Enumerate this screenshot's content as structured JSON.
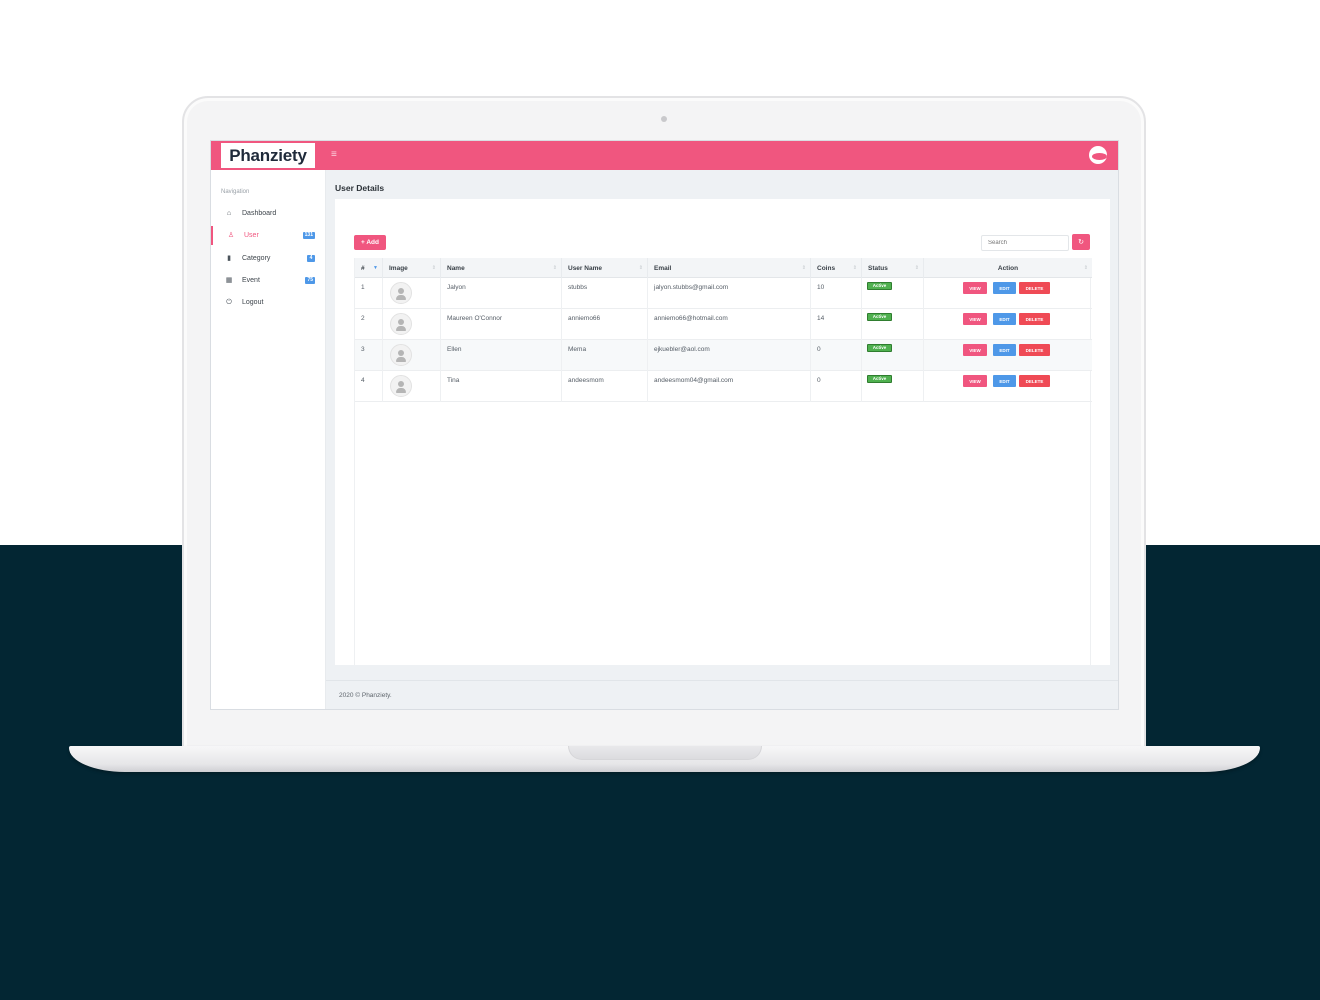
{
  "header": {
    "logo_text": "Phanziety",
    "menu_toggle": "≡"
  },
  "sidebar": {
    "heading": "Navigation",
    "items": [
      {
        "label": "Dashboard",
        "icon": "home-icon",
        "glyph": "⌂",
        "badge": ""
      },
      {
        "label": "User",
        "icon": "user-icon",
        "glyph": "♙",
        "badge": "131"
      },
      {
        "label": "Category",
        "icon": "bar-chart-icon",
        "glyph": "▮",
        "badge": "4"
      },
      {
        "label": "Event",
        "icon": "grid-icon",
        "glyph": "▦",
        "badge": "75"
      },
      {
        "label": "Logout",
        "icon": "power-icon",
        "glyph": "⏻",
        "badge": ""
      }
    ]
  },
  "main": {
    "title": "User Details",
    "add_label": "+ Add",
    "search_placeholder": "Search",
    "refresh_glyph": "↻"
  },
  "table": {
    "columns": [
      "#",
      "Image",
      "Name",
      "User Name",
      "Email",
      "Coins",
      "Status",
      "Action"
    ],
    "rows": [
      {
        "num": "1",
        "name": "Jalyon",
        "username": "stubbs",
        "email": "jalyon.stubbs@gmail.com",
        "coins": "10",
        "status": "Active"
      },
      {
        "num": "2",
        "name": "Maureen O'Connor",
        "username": "anniemo66",
        "email": "anniemo66@hotmail.com",
        "coins": "14",
        "status": "Active"
      },
      {
        "num": "3",
        "name": "Ellen",
        "username": "Mema",
        "email": "ejkuebler@aol.com",
        "coins": "0",
        "status": "Active"
      },
      {
        "num": "4",
        "name": "Tina",
        "username": "andeesmom",
        "email": "andeesmom04@gmail.com",
        "coins": "0",
        "status": "Active"
      }
    ],
    "actions": {
      "view": "VIEW",
      "edit": "EDIT",
      "delete": "DELETE"
    }
  },
  "footer": {
    "text": "2020 © Phanziety."
  },
  "colors": {
    "accent": "#f0567f",
    "info": "#4e98e8",
    "danger": "#ef4a55",
    "success": "#4fb04f",
    "backdrop": "#032633"
  }
}
